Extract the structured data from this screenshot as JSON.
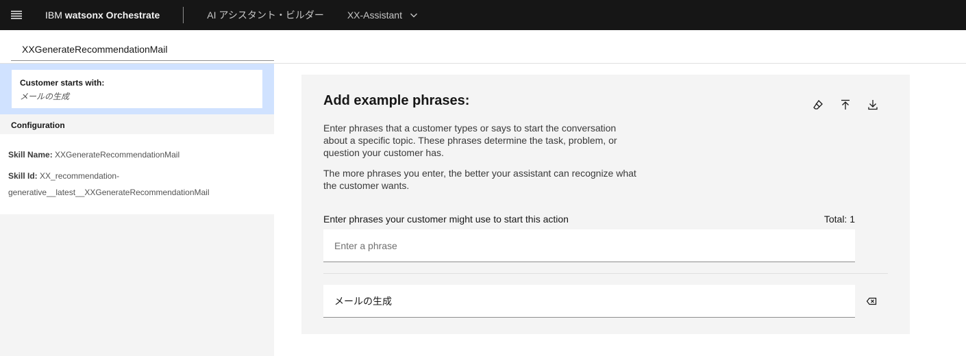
{
  "header": {
    "brand_prefix": "IBM",
    "brand_name": "watsonx Orchestrate",
    "nav_builder": "AI アシスタント・ビルダー",
    "assistant_name": "XX-Assistant"
  },
  "action": {
    "name": "XXGenerateRecommendationMail"
  },
  "sidebar": {
    "step_title": "Customer starts with:",
    "step_subtitle": "メールの生成",
    "config_title": "Configuration",
    "skill_name_label": "Skill Name:",
    "skill_name_value": "XXGenerateRecommendationMail",
    "skill_id_label": "Skill Id:",
    "skill_id_value": "XX_recommendation-generative__latest__XXGenerateRecommendationMail"
  },
  "main": {
    "title": "Add example phrases:",
    "description_1": "Enter phrases that a customer types or says to start the conversation about a specific topic. These phrases determine the task, problem, or question your customer has.",
    "description_2": "The more phrases you enter, the better your assistant can recognize what the customer wants.",
    "field_label": "Enter phrases your customer might use to start this action",
    "total": "Total: 1",
    "input_placeholder": "Enter a phrase",
    "phrases": [
      "メールの生成"
    ]
  },
  "icons": {
    "menu": "hamburger-menu-icon",
    "chevron": "chevron-down-icon",
    "edit": "eraser-icon",
    "upload": "upload-icon",
    "download": "download-icon",
    "delete": "backspace-delete-icon"
  }
}
